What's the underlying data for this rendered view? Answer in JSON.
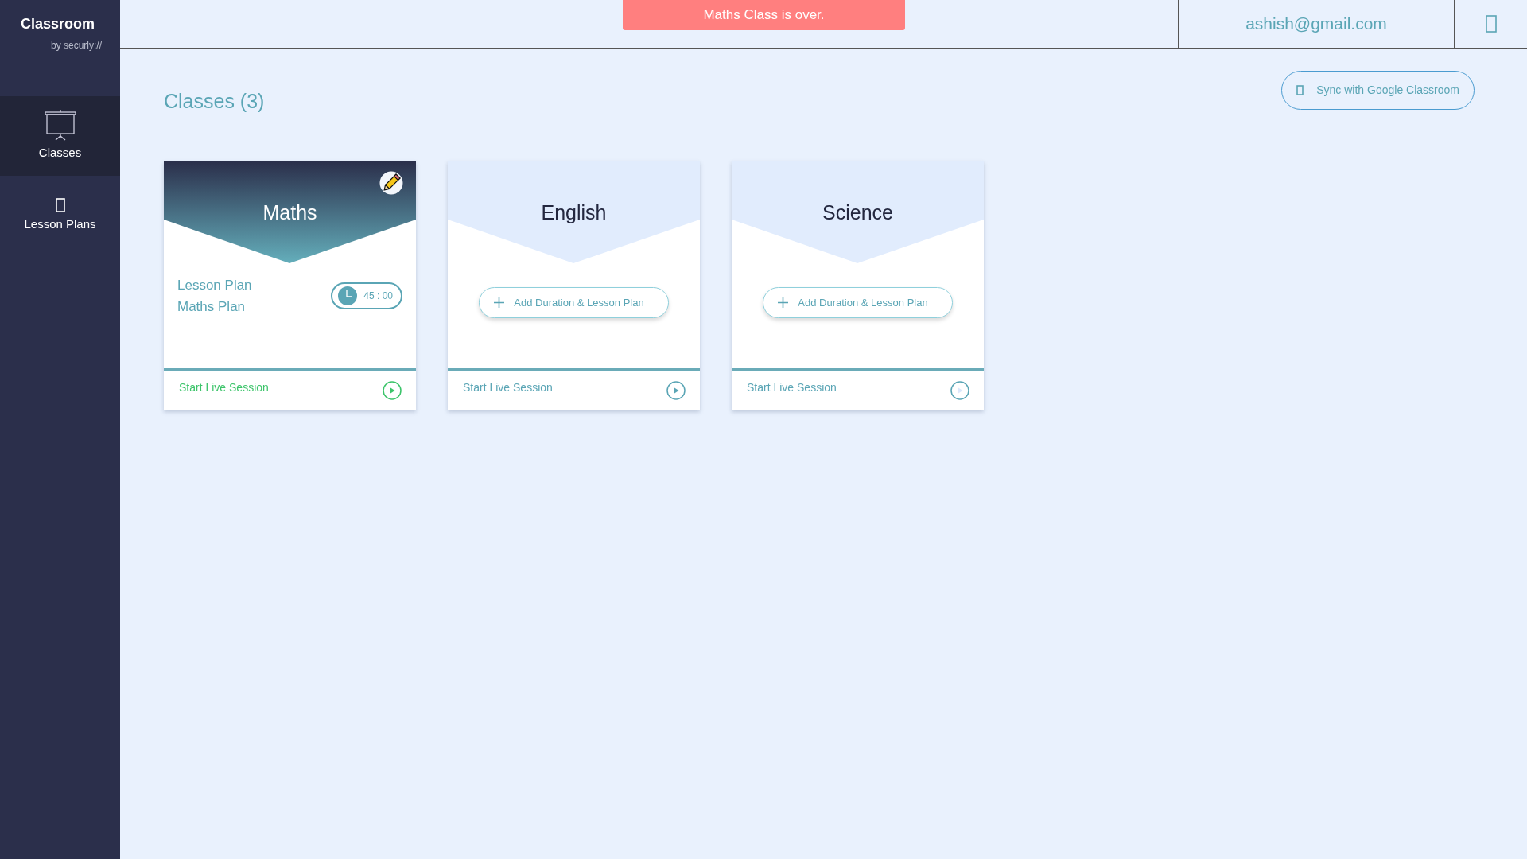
{
  "brand": {
    "name": "Classroom",
    "tagline": "by securly://"
  },
  "sidebar": {
    "items": [
      {
        "label": "Classes",
        "selected": true
      },
      {
        "label": "Lesson Plans",
        "selected": false
      }
    ]
  },
  "topbar": {
    "alert": "Maths Class is over.",
    "user_email": "ashish@gmail.com"
  },
  "page": {
    "title": "Classes (3)",
    "sync_button": "Sync with Google Classroom"
  },
  "classes": [
    {
      "name": "Maths",
      "active": true,
      "kind": "planned",
      "lesson_label": "Lesson Plan",
      "lesson_name": "Maths Plan",
      "duration": "45 : 00",
      "session_label": "Start Live Session",
      "disabled": false
    },
    {
      "name": "English",
      "active": false,
      "kind": "empty",
      "add_button": "Add Duration & Lesson Plan",
      "session_label": "Start Live Session",
      "disabled": false
    },
    {
      "name": "Science",
      "active": false,
      "kind": "empty",
      "add_button": "Add Duration & Lesson Plan",
      "session_label": "Start Live Session",
      "disabled": true
    }
  ]
}
